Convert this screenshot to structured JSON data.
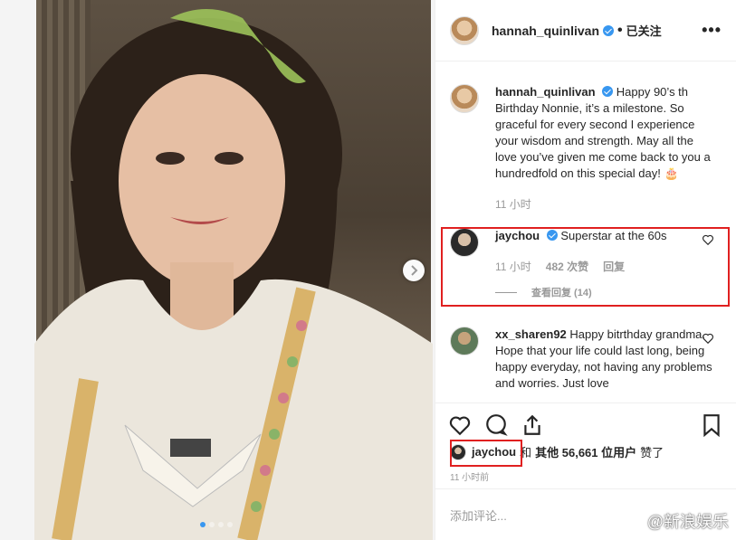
{
  "post": {
    "username": "hannah_quinlivan",
    "follow_status": "已关注",
    "separator": "•",
    "more": "•••"
  },
  "caption": {
    "username": "hannah_quinlivan",
    "text": "Happy 90’s th Birthday Nonnie, it’s a milestone. So graceful for every second I experience your wisdom and strength. May all the love you’ve given me come back to you a hundredfold on this special day! 🎂",
    "time": "11 小时"
  },
  "comments": [
    {
      "username": "jaychou",
      "verified": true,
      "text": "Superstar at the 60s",
      "time": "11 小时",
      "likes": "482 次赞",
      "reply": "回复",
      "view_replies": "查看回复 (14)"
    },
    {
      "username": "xx_sharen92",
      "verified": false,
      "text": "Happy bitrthday grandma. Hope that your life could last long, being happy everyday, not having any problems and worries. Just love"
    }
  ],
  "likes_line": {
    "liker": "jaychou",
    "and": "和",
    "others": "其他 56,661 位用户",
    "liked": "赞了"
  },
  "timestamp": "11 小时前",
  "add_comment": {
    "placeholder": "添加评论..."
  },
  "carousel": {
    "total": 4,
    "active": 1
  },
  "watermark": {
    "text": "@新浪娱乐"
  },
  "colors": {
    "highlight": "#e02020",
    "verified": "#3897f0"
  }
}
